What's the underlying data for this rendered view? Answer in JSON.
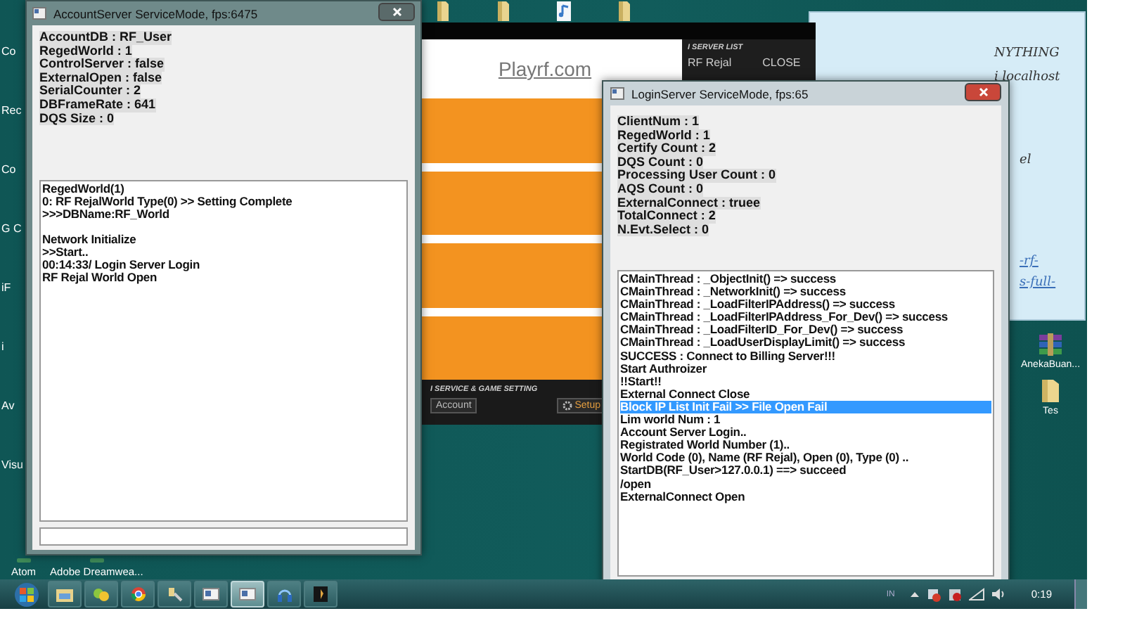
{
  "desktop_icons_left": [
    {
      "label": "Co"
    },
    {
      "label": "Rec"
    },
    {
      "label": "Co"
    },
    {
      "label": "G C"
    },
    {
      "label": "iF"
    },
    {
      "label": "i"
    },
    {
      "label": "Av"
    },
    {
      "label": "Visu"
    }
  ],
  "desktop_icons_bottom": [
    {
      "label": "Atom",
      "kind": "app"
    },
    {
      "label": "Adobe Dreamwea...",
      "kind": "app"
    }
  ],
  "desktop_icons_right": [
    {
      "label": "AnekaBuan...",
      "kind": "archive"
    },
    {
      "label": "Tes",
      "kind": "folder"
    }
  ],
  "top_icons": [
    {
      "kind": "folder"
    },
    {
      "kind": "folder"
    },
    {
      "kind": "file"
    },
    {
      "kind": "folder"
    }
  ],
  "launcher": {
    "site_link": "Playrf.com",
    "server_list_heading": "I SERVER LIST",
    "server": "RF Rejal",
    "close_button": "CLOSE",
    "settings_heading": "I SERVICE & GAME SETTING",
    "account_button": "Account",
    "setup_button": "Setup"
  },
  "note": {
    "lines": [
      {
        "text": "NYTHING",
        "kind": "text"
      },
      {
        "text": "i localhost",
        "kind": "text"
      },
      {
        "text": "el",
        "kind": "text"
      },
      {
        "text": "-rf-",
        "kind": "link"
      },
      {
        "text": "s-full-",
        "kind": "link"
      }
    ]
  },
  "account_window": {
    "title": "AccountServer ServiceMode, fps:6475",
    "stats": [
      "AccountDB : RF_User",
      "RegedWorld : 1",
      "ControlServer : false",
      "ExternalOpen : false",
      "SerialCounter : 2",
      "DBFrameRate : 641",
      "DQS Size : 0"
    ],
    "log_groups": [
      [
        "RegedWorld(1)",
        "0: RF RejalWorld Type(0) >> Setting Complete",
        ">>>DBName:RF_World"
      ],
      [
        "Network Initialize",
        ">>Start..",
        "00:14:33/ Login Server Login",
        "RF Rejal World Open"
      ]
    ]
  },
  "login_window": {
    "title": "LoginServer ServiceMode, fps:65",
    "stats": [
      "ClientNum : 1",
      "RegedWorld : 1",
      "Certify Count : 2",
      "DQS Count : 0",
      "Processing User Count : 0",
      "AQS Count : 0",
      "ExternalConnect : truee",
      "TotalConnect : 2",
      "N.Evt.Select : 0"
    ],
    "log": [
      {
        "text": "CMainThread : _ObjectInit() => success",
        "selected": false
      },
      {
        "text": "CMainThread : _NetworkInit() => success",
        "selected": false
      },
      {
        "text": "CMainThread : _LoadFilterIPAddress() => success",
        "selected": false
      },
      {
        "text": "CMainThread : _LoadFilterIPAddress_For_Dev() => success",
        "selected": false
      },
      {
        "text": "CMainThread : _LoadFilterID_For_Dev() => success",
        "selected": false
      },
      {
        "text": "CMainThread : _LoadUserDisplayLimit() => success",
        "selected": false
      },
      {
        "text": "SUCCESS : Connect to Billing Server!!!",
        "selected": false
      },
      {
        "text": "Start Authroizer",
        "selected": false
      },
      {
        "text": "!!Start!!",
        "selected": false
      },
      {
        "text": "External Connect Close",
        "selected": false
      },
      {
        "text": "Block IP List Init Fail >> File Open Fail",
        "selected": true
      },
      {
        "text": "Lim world Num : 1",
        "selected": false
      },
      {
        "text": "Account Server Login..",
        "selected": false
      },
      {
        "text": "Registrated World Number (1)..",
        "selected": false
      },
      {
        "text": "World Code (0), Name (RF Rejal), Open (0), Type (0) ..",
        "selected": false
      },
      {
        "text": "StartDB(RF_User>127.0.0.1) ==> succeed",
        "selected": false
      },
      {
        "text": "/open",
        "selected": false
      },
      {
        "text": "ExternalConnect Open",
        "selected": false
      }
    ]
  },
  "taskbar": {
    "buttons": [
      {
        "kind": "folder",
        "active": false
      },
      {
        "kind": "chat",
        "active": false
      },
      {
        "kind": "browser",
        "active": false
      },
      {
        "kind": "tool",
        "active": false
      },
      {
        "kind": "window",
        "active": false
      },
      {
        "kind": "window",
        "active": true
      },
      {
        "kind": "headphones",
        "active": false
      },
      {
        "kind": "app",
        "active": false
      }
    ],
    "language": "IN",
    "clock": "0:19"
  }
}
